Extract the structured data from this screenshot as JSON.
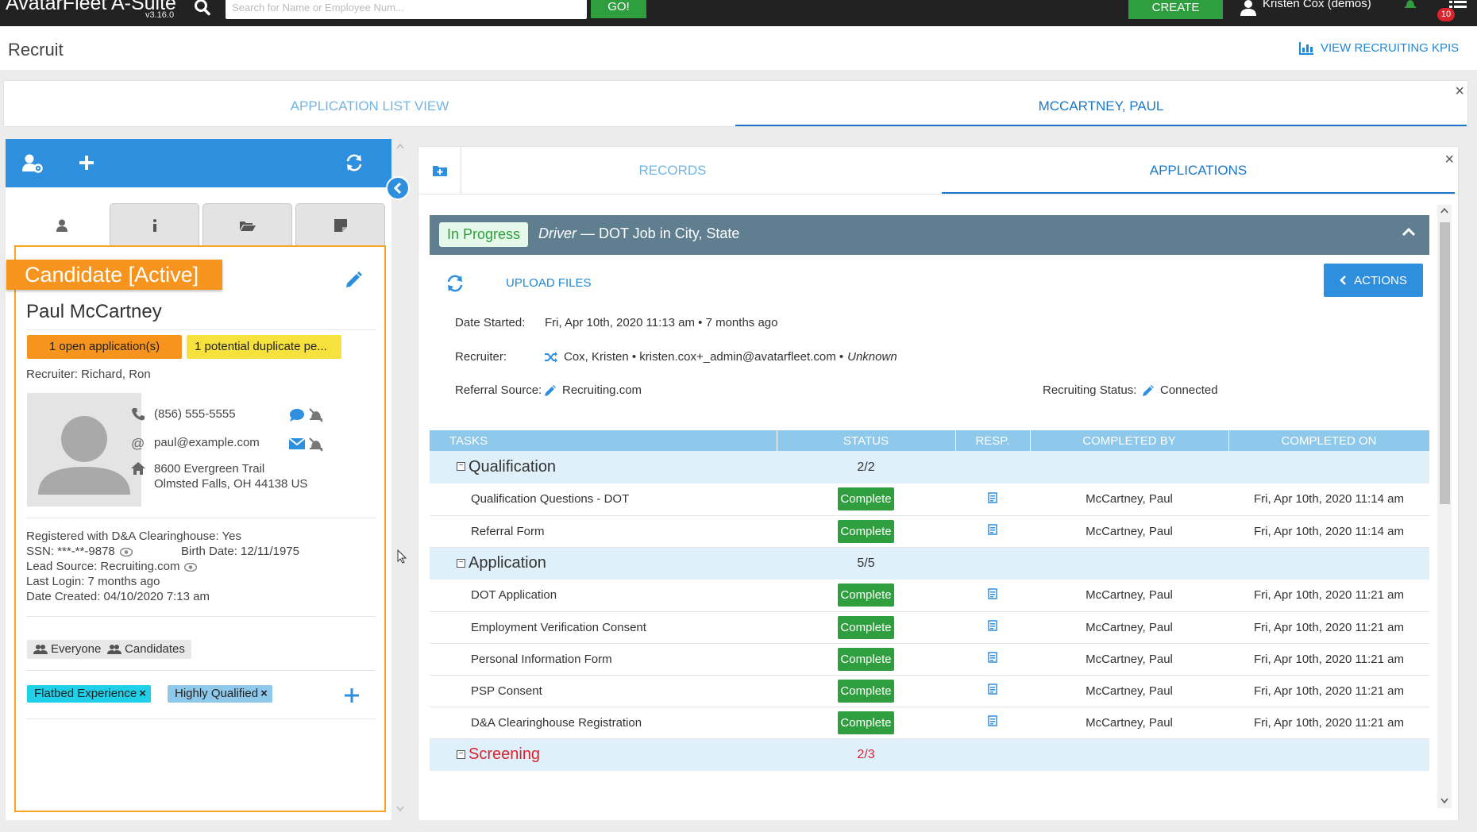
{
  "topbar": {
    "brand": "AvatarFleet A-Suite",
    "version": "v3.16.0",
    "search_placeholder": "Search for Name or Employee Num...",
    "go_label": "GO!",
    "create_label": "CREATE",
    "user_name": "Kristen Cox (demos)",
    "notification_count": "10"
  },
  "header": {
    "title": "Recruit",
    "kpi_link": "VIEW RECRUITING KPIS"
  },
  "top_tabs": [
    {
      "label": "APPLICATION LIST VIEW",
      "active": false
    },
    {
      "label": "MCCARTNEY, PAUL",
      "active": true
    }
  ],
  "candidate": {
    "status_banner": "Candidate [Active]",
    "name": "Paul McCartney",
    "badge_applications": "1 open application(s)",
    "badge_duplicates": "1 potential duplicate pe...",
    "recruiter": "Recruiter: Richard, Ron",
    "phone": "(856) 555-5555",
    "email": "paul@example.com",
    "address_line1": "8600 Evergreen Trail",
    "address_line2": "Olmsted Falls, OH 44138 US",
    "clearinghouse": "Registered with D&A Clearinghouse: Yes",
    "ssn": "SSN: ***-**-9878",
    "birth_date": "Birth Date: 12/11/1975",
    "lead_source": "Lead Source: Recruiting.com",
    "last_login": "Last Login: 7 months ago",
    "date_created": "Date Created: 04/10/2020 7:13 am",
    "groups": [
      "Everyone",
      "Candidates"
    ],
    "tags": [
      {
        "label": "Flatbed Experience",
        "color": "#1fd0e8"
      },
      {
        "label": "Highly Qualified",
        "color": "#8ec8ea"
      }
    ]
  },
  "right_tabs": [
    {
      "label": "RECORDS",
      "active": false
    },
    {
      "label": "APPLICATIONS",
      "active": true
    }
  ],
  "application": {
    "status": "In Progress",
    "job_title": "Driver",
    "job_detail": " — DOT Job in City, State",
    "upload_label": "UPLOAD FILES",
    "actions_label": "ACTIONS",
    "date_started_label": "Date Started:",
    "date_started": "Fri, Apr 10th, 2020 11:13 am • 7 months ago",
    "recruiter_label": "Recruiter:",
    "recruiter_value": "Cox, Kristen • kristen.cox+_admin@avatarfleet.com •",
    "recruiter_extra": "Unknown",
    "referral_label": "Referral Source:",
    "referral_value": "Recruiting.com",
    "recruiting_status_label": "Recruiting Status:",
    "recruiting_status_value": "Connected"
  },
  "tasks": {
    "columns": [
      "TASKS",
      "STATUS",
      "RESP.",
      "COMPLETED BY",
      "COMPLETED ON"
    ],
    "groups": [
      {
        "name": "Qualification",
        "count": "2/2",
        "items": [
          {
            "task": "Qualification Questions - DOT",
            "status": "Complete",
            "by": "McCartney, Paul",
            "on": "Fri, Apr 10th, 2020 11:14 am"
          },
          {
            "task": "Referral Form",
            "status": "Complete",
            "by": "McCartney, Paul",
            "on": "Fri, Apr 10th, 2020 11:14 am"
          }
        ]
      },
      {
        "name": "Application",
        "count": "5/5",
        "items": [
          {
            "task": "DOT Application",
            "status": "Complete",
            "by": "McCartney, Paul",
            "on": "Fri, Apr 10th, 2020 11:21 am"
          },
          {
            "task": "Employment Verification Consent",
            "status": "Complete",
            "by": "McCartney, Paul",
            "on": "Fri, Apr 10th, 2020 11:21 am"
          },
          {
            "task": "Personal Information Form",
            "status": "Complete",
            "by": "McCartney, Paul",
            "on": "Fri, Apr 10th, 2020 11:21 am"
          },
          {
            "task": "PSP Consent",
            "status": "Complete",
            "by": "McCartney, Paul",
            "on": "Fri, Apr 10th, 2020 11:21 am"
          },
          {
            "task": "D&A Clearinghouse Registration",
            "status": "Complete",
            "by": "McCartney, Paul",
            "on": "Fri, Apr 10th, 2020 11:21 am"
          }
        ]
      },
      {
        "name": "Screening",
        "count": "2/3",
        "items": []
      }
    ]
  },
  "colors": {
    "accent_blue": "#2f8fdf",
    "success_green": "#2f9e3e",
    "candidate_orange": "#f7941d",
    "duplicate_yellow": "#f7e23d"
  }
}
